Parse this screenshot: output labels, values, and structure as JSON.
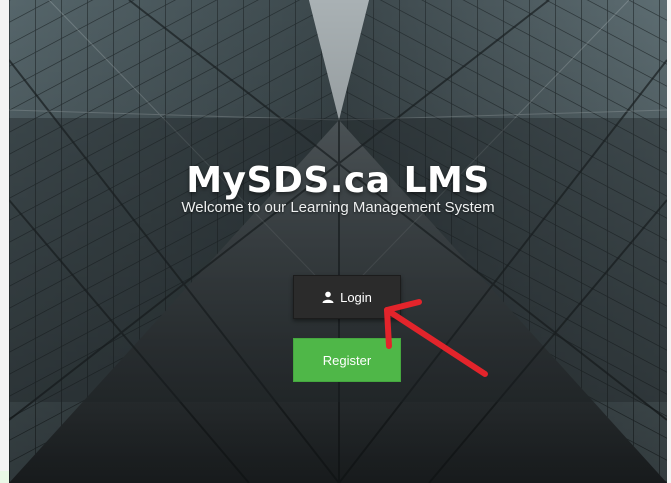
{
  "hero": {
    "title": "MySDS.ca LMS",
    "subtitle": "Welcome to our Learning Management System"
  },
  "buttons": {
    "login_label": "Login",
    "register_label": "Register"
  },
  "icons": {
    "login_icon": "user-icon",
    "annotation": "red-arrow-icon"
  },
  "colors": {
    "login_bg": "#2b2b2b",
    "register_bg": "#4fb748",
    "annotation": "#e3242b"
  }
}
